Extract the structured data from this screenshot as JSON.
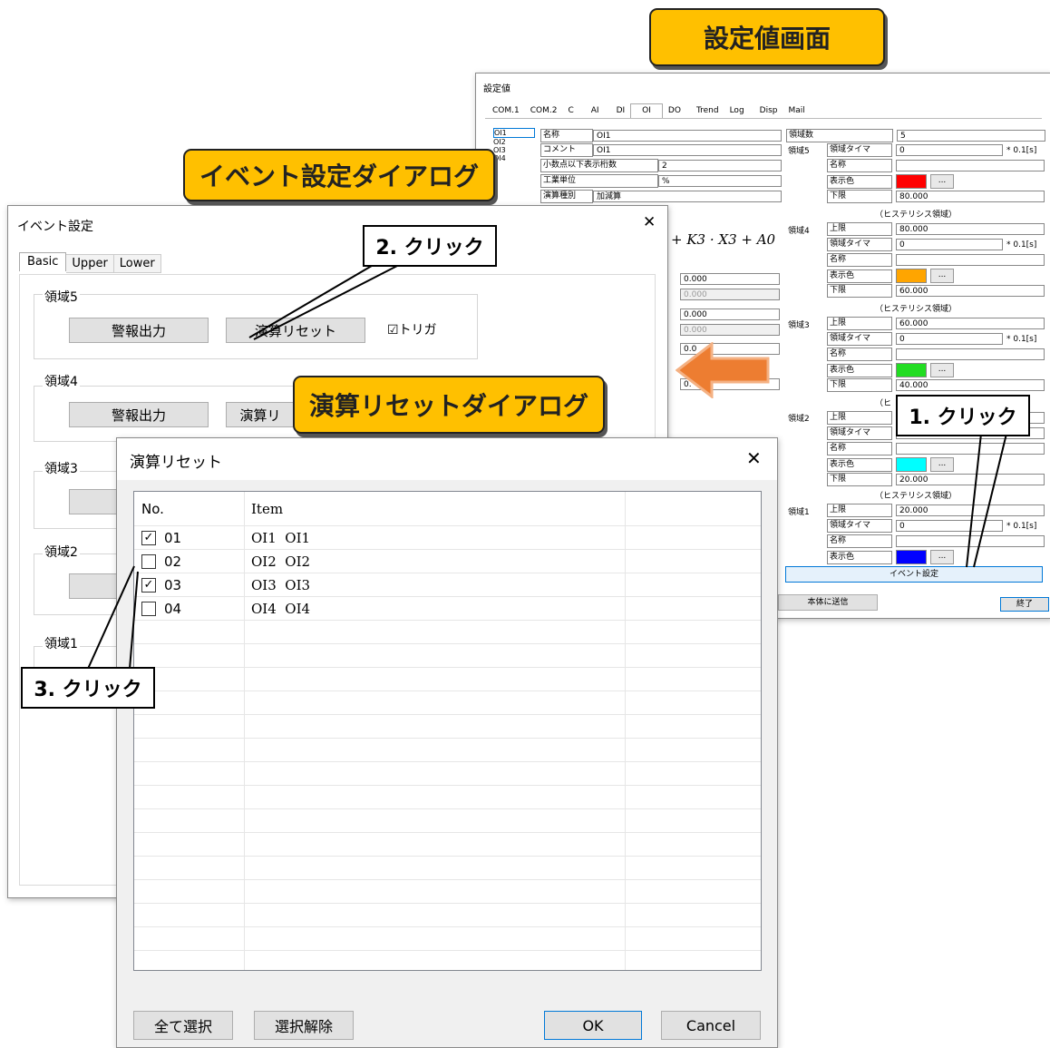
{
  "callouts": {
    "settings_screen": "設定値画面",
    "event_dialog": "イベント設定ダイアログ",
    "reset_dialog": "演算リセットダイアログ"
  },
  "steps": {
    "step1": "1. クリック",
    "step2": "2. クリック",
    "step3": "3. クリック"
  },
  "settings": {
    "title": "設定値",
    "tabs": [
      "COM.1",
      "COM.2",
      "C",
      "AI",
      "DI",
      "OI",
      "DO",
      "Trend",
      "Log",
      "Disp",
      "Mail"
    ],
    "active_tab": "OI",
    "oi_list": [
      "OI1",
      "OI2",
      "OI3",
      "OI4"
    ],
    "name_label": "名称",
    "name_value": "OI1",
    "comment_label": "コメント",
    "comment_value": "OI1",
    "decimals_label": "小数点以下表示桁数",
    "decimals_value": "2",
    "unit_label": "工業単位",
    "unit_value": "%",
    "calc_label": "演算種別",
    "calc_value": "加減算",
    "formula": "+ K3 · X3 + A0",
    "mid_values": [
      "0.000",
      "0.000",
      "0.000",
      "0.000",
      "0.0",
      "0."
    ],
    "region_count_label": "領域数",
    "region_count_value": "5",
    "hysteresis": "（ヒステリシス領域）",
    "hysteresis_partial": "（ヒ",
    "timer_unit": "* 0.1[s]",
    "l_upper": "上限",
    "l_lower": "下限",
    "l_timer": "領域タイマ",
    "l_name": "名称",
    "l_color": "表示色",
    "regions": [
      {
        "label": "領域5",
        "timer": "0",
        "lower": "80.000",
        "color": "#ff0000"
      },
      {
        "label": "領域4",
        "upper": "80.000",
        "timer": "0",
        "lower": "60.000",
        "color": "#ffa500"
      },
      {
        "label": "領域3",
        "upper": "60.000",
        "timer": "0",
        "lower": "40.000",
        "color": "#22dd22"
      },
      {
        "label": "領域2",
        "lower": "20.000",
        "color": "#00ffff"
      },
      {
        "label": "領域1",
        "upper": "20.000",
        "timer": "0",
        "color": "#0000ff"
      }
    ],
    "dots": "...",
    "event_button": "イベント設定",
    "send_button": "本体に送信",
    "exit_button": "終了"
  },
  "event_dialog": {
    "title": "イベント設定",
    "close": "✕",
    "tabs": [
      "Basic",
      "Upper",
      "Lower"
    ],
    "groups": [
      "領域5",
      "領域4",
      "領域3",
      "領域2",
      "領域1"
    ],
    "alarm_button": "警報出力",
    "reset_button": "演算リセット",
    "reset_partial": "演算リ",
    "trigger_label": "トリガ",
    "trigger_checked": "☑"
  },
  "reset_dialog": {
    "title": "演算リセット",
    "close": "✕",
    "columns": [
      "No.",
      "Item"
    ],
    "rows": [
      {
        "no": "01",
        "item": "OI1  OI1",
        "checked": "✓"
      },
      {
        "no": "02",
        "item": "OI2  OI2",
        "checked": ""
      },
      {
        "no": "03",
        "item": "OI3  OI3",
        "checked": "✓"
      },
      {
        "no": "04",
        "item": "OI4  OI4",
        "checked": ""
      }
    ],
    "select_all": "全て選択",
    "deselect": "選択解除",
    "ok": "OK",
    "cancel": "Cancel"
  }
}
